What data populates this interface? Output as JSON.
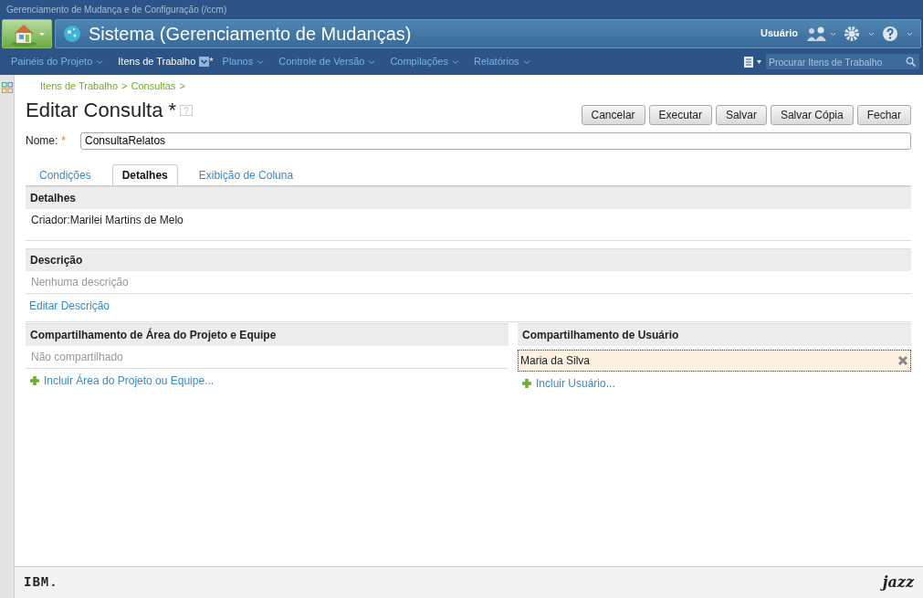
{
  "window": {
    "title": "Gerenciamento de Mudança e de Configuração (/ccm)"
  },
  "banner": {
    "title": "Sistema (Gerenciamento de Mudanças)",
    "user": "Usuário"
  },
  "nav": {
    "items": [
      {
        "label": "Painéis do Projeto",
        "selected": false
      },
      {
        "label": "Itens de Trabalho",
        "selected": true,
        "suffix": "*"
      },
      {
        "label": "Planos",
        "selected": false
      },
      {
        "label": "Controle de Versão",
        "selected": false
      },
      {
        "label": "Compilações",
        "selected": false
      },
      {
        "label": "Relatórios",
        "selected": false
      }
    ],
    "search": {
      "placeholder": "Procurar Itens de Trabalho"
    }
  },
  "breadcrumb": [
    "Itens de Trabalho",
    ">",
    "Consultas",
    ">"
  ],
  "page": {
    "title": "Editar Consulta *",
    "buttons": [
      "Cancelar",
      "Executar",
      "Salvar",
      "Salvar Cópia",
      "Fechar"
    ]
  },
  "name_field": {
    "label": "Nome:",
    "required_mark": "*",
    "value": "ConsultaRelatos"
  },
  "tabs": [
    {
      "label": "Condições",
      "selected": false
    },
    {
      "label": "Detalhes",
      "selected": true
    },
    {
      "label": "Exibição de Coluna",
      "selected": false
    }
  ],
  "details": {
    "heading": "Detalhes",
    "creator": "Criador:Marilei Martins de Melo"
  },
  "description": {
    "heading": "Descrição",
    "text": "Nenhuma descrição",
    "link": "Editar Descrição"
  },
  "team_sharing": {
    "heading": "Compartilhamento de Área do Projeto e Equipe",
    "empty": "Não compartilhado",
    "add": "Incluir Área do Projeto ou Equipe..."
  },
  "user_sharing": {
    "heading": "Compartilhamento de Usuário",
    "users": [
      "Maria da Silva"
    ],
    "add": "Incluir Usuário..."
  },
  "footer": {
    "left_logo": "IBM.",
    "right_logo": "jazz"
  }
}
